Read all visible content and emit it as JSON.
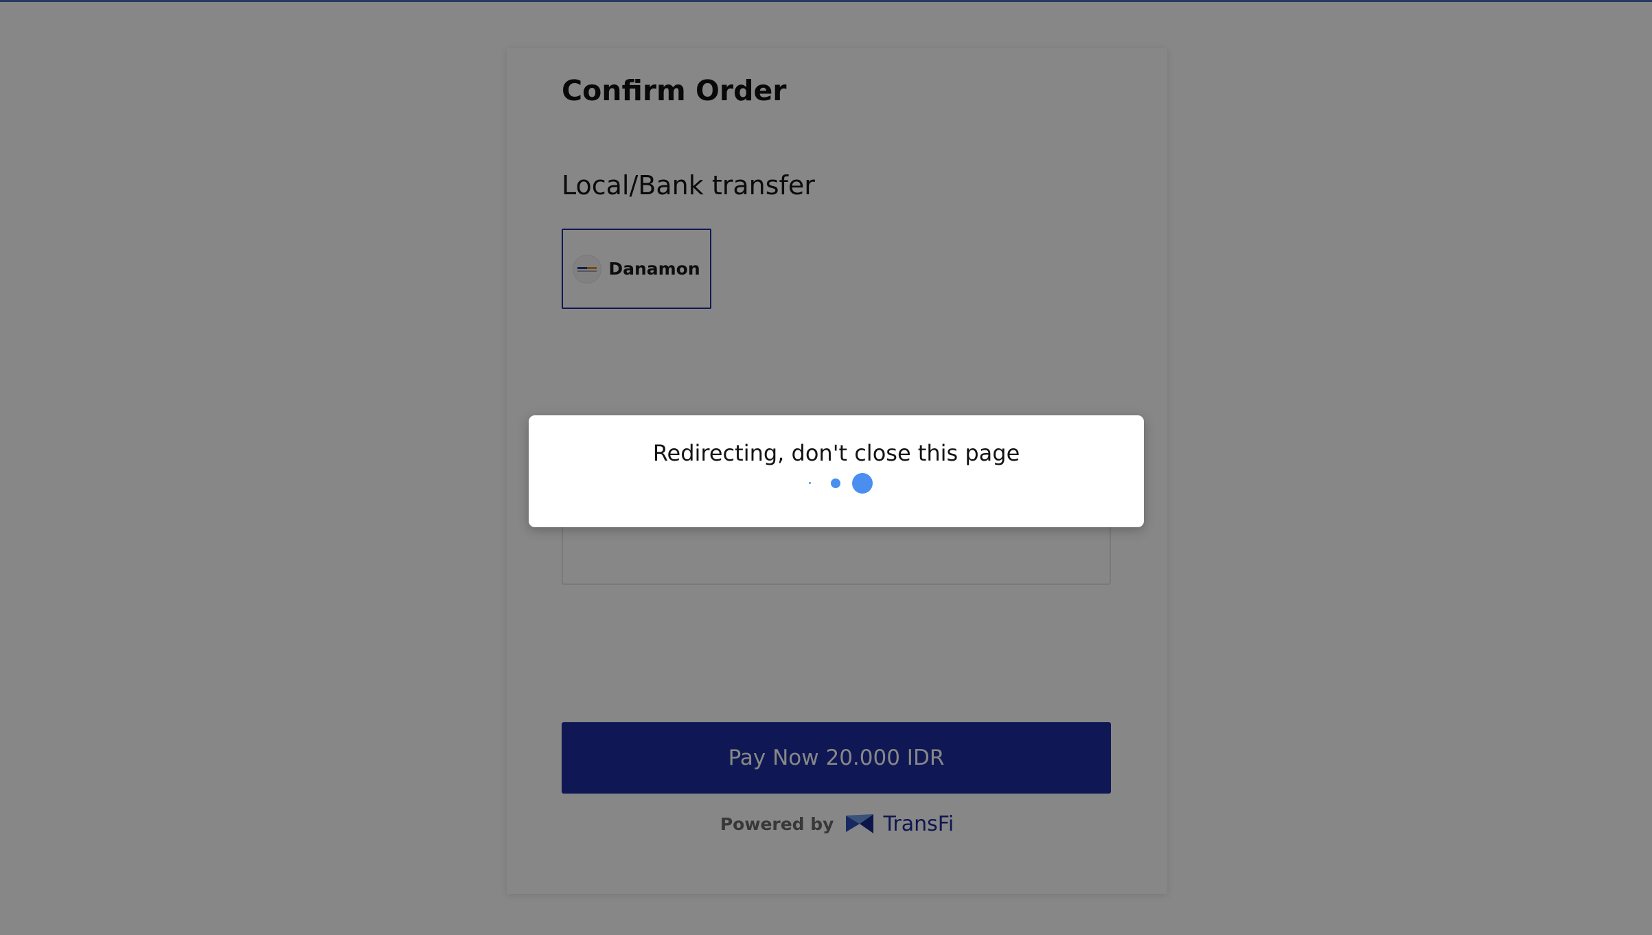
{
  "page": {
    "title": "Confirm Order"
  },
  "payment": {
    "section_title": "Local/Bank transfer",
    "selected_bank": {
      "name": "Danamon",
      "icon": "danamon-logo"
    }
  },
  "pay_button": {
    "label": "Pay Now 20.000 IDR"
  },
  "footer": {
    "powered_by": "Powered by",
    "brand": "TransFi",
    "brand_icon": "transfi-logo"
  },
  "modal": {
    "message": "Redirecting, don't close this page",
    "loader_icon": "loading-dots"
  },
  "colors": {
    "accent": "#1d2f9f",
    "brand_text": "#1d2a9b",
    "loader": "#4a8ff0",
    "top_bar": "#4a6fb5"
  }
}
